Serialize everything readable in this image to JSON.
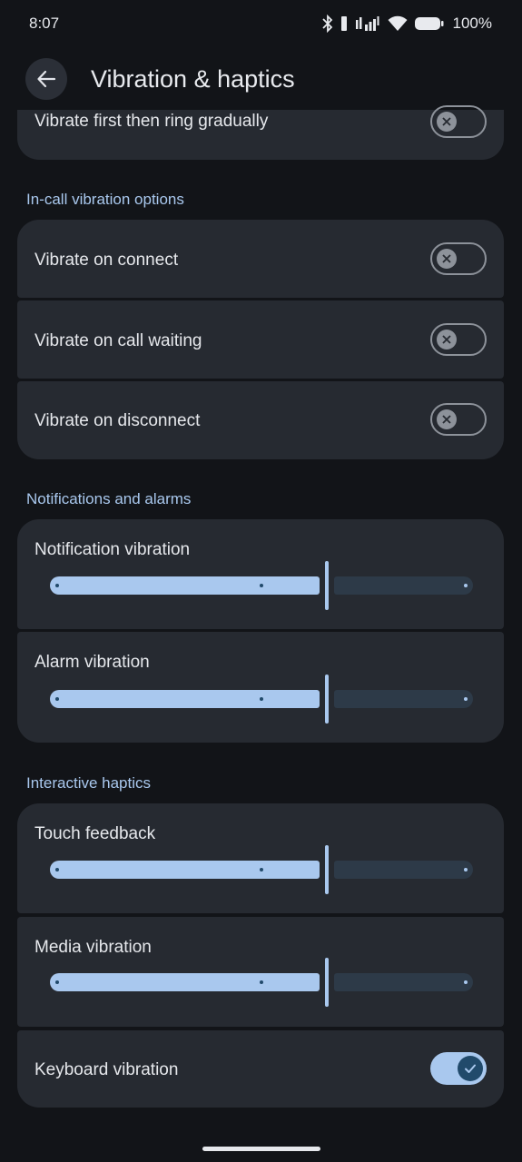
{
  "status_bar": {
    "time": "8:07",
    "battery_percent": "100%"
  },
  "app_bar": {
    "title": "Vibration & haptics"
  },
  "ringing": {
    "vibrate_first_label": "Vibrate first then ring gradually",
    "vibrate_first_enabled": false
  },
  "in_call": {
    "header": "In-call vibration options",
    "items": [
      {
        "label": "Vibrate on connect",
        "enabled": false
      },
      {
        "label": "Vibrate on call waiting",
        "enabled": false
      },
      {
        "label": "Vibrate on disconnect",
        "enabled": false
      }
    ]
  },
  "notifications": {
    "header": "Notifications and alarms",
    "sliders": [
      {
        "label": "Notification vibration",
        "value_fraction": 0.65
      },
      {
        "label": "Alarm vibration",
        "value_fraction": 0.65
      }
    ]
  },
  "interactive": {
    "header": "Interactive haptics",
    "sliders": [
      {
        "label": "Touch feedback",
        "value_fraction": 0.65
      },
      {
        "label": "Media vibration",
        "value_fraction": 0.65
      }
    ],
    "keyboard": {
      "label": "Keyboard vibration",
      "enabled": true
    }
  },
  "colors": {
    "background": "#121418",
    "card": "#262a31",
    "accent": "#a9c8ee",
    "section_header": "#a9c8ee"
  }
}
